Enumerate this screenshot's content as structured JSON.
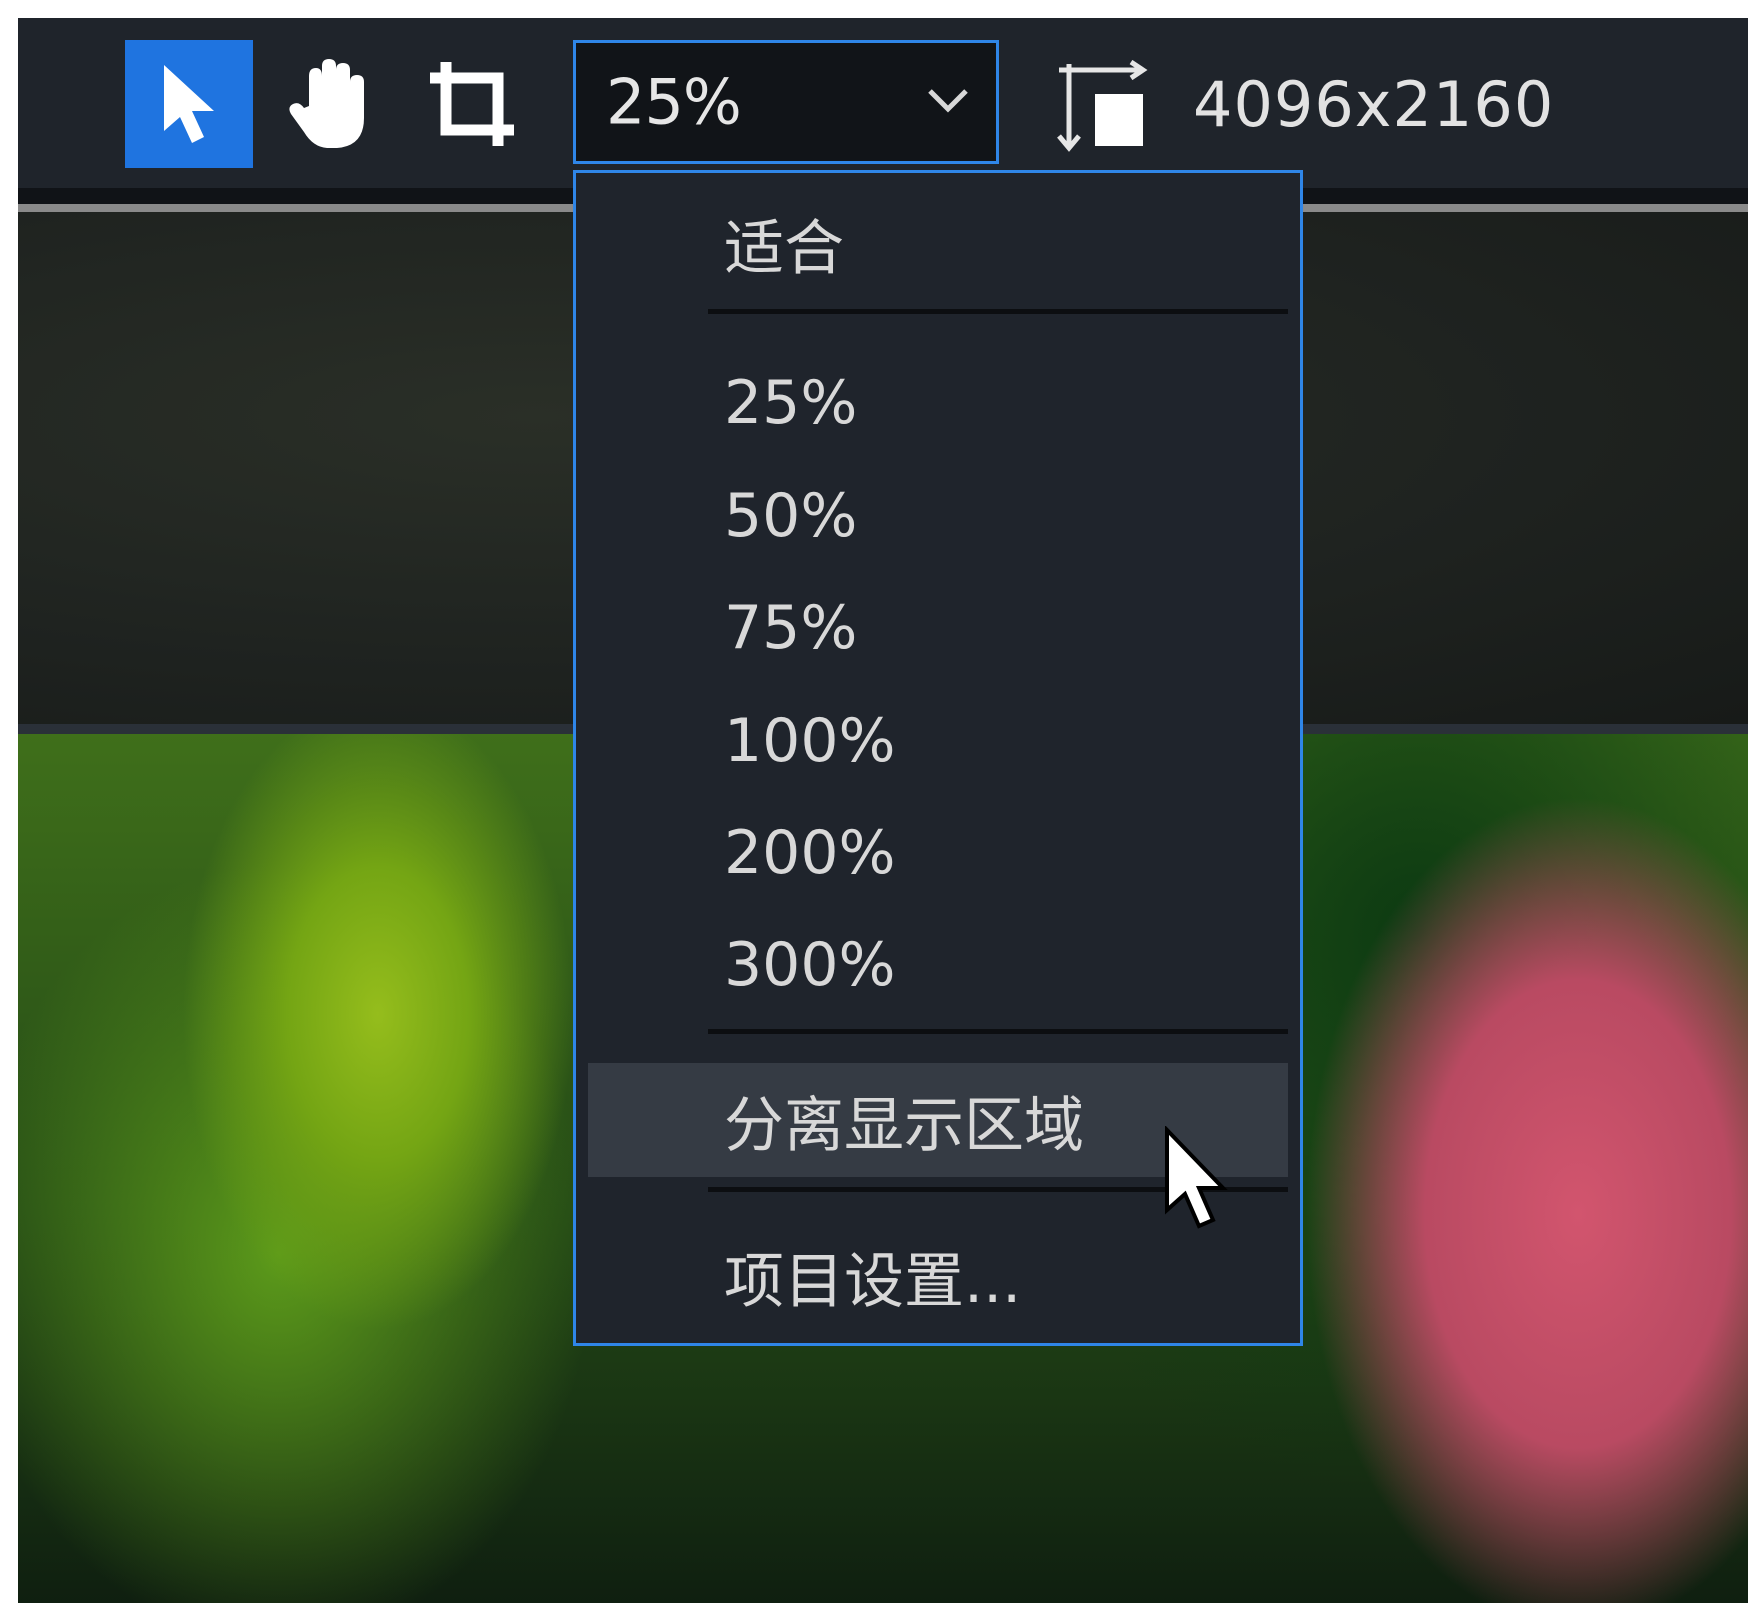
{
  "toolbar": {
    "tools": [
      {
        "name": "select",
        "icon": "arrow-pointer-icon",
        "active": true
      },
      {
        "name": "pan",
        "icon": "hand-icon",
        "active": false
      },
      {
        "name": "crop",
        "icon": "crop-icon",
        "active": false
      }
    ],
    "zoom_select": {
      "value": "25%",
      "icon": "chevron-down-icon"
    },
    "resolution_icon": "resolution-icon",
    "resolution": "4096x2160"
  },
  "zoom_menu": {
    "fit_label": "适合",
    "zoom_levels": [
      "25%",
      "50%",
      "75%",
      "100%",
      "200%",
      "300%"
    ],
    "split_view_label": "分离显示区域",
    "project_settings_label": "项目设置...",
    "hovered_item": "分离显示区域"
  },
  "colors": {
    "accent": "#1f74e0",
    "focus_border": "#2f86e8",
    "toolbar_bg": "#1f242b",
    "menu_bg": "#1f242c",
    "menu_hover_bg": "#353b44"
  }
}
